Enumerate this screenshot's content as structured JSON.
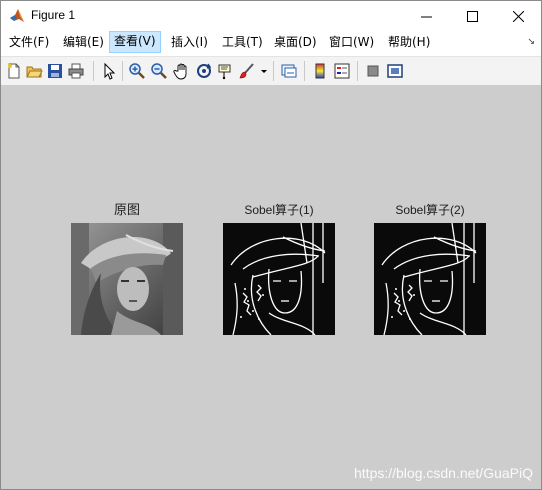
{
  "window": {
    "title": "Figure 1",
    "icon": "matlab-icon"
  },
  "menu": {
    "items": [
      {
        "label": "文件(F)",
        "active": false
      },
      {
        "label": "编辑(E)",
        "active": false
      },
      {
        "label": "查看(V)",
        "active": true
      },
      {
        "label": "插入(I)",
        "active": false
      },
      {
        "label": "工具(T)",
        "active": false
      },
      {
        "label": "桌面(D)",
        "active": false
      },
      {
        "label": "窗口(W)",
        "active": false
      },
      {
        "label": "帮助(H)",
        "active": false
      }
    ]
  },
  "toolbar": {
    "icons": [
      "new-figure-icon",
      "open-file-icon",
      "save-icon",
      "print-icon",
      "select-arrow-icon",
      "zoom-in-icon",
      "zoom-out-icon",
      "pan-hand-icon",
      "rotate-3d-icon",
      "data-cursor-icon",
      "brush-icon",
      "brush-dropdown-icon",
      "link-plot-icon",
      "colorbar-icon",
      "legend-icon",
      "hide-plot-tools-icon",
      "show-plot-tools-icon"
    ]
  },
  "axes": [
    {
      "title": "原图",
      "image": "grayscale-portrait"
    },
    {
      "title": "Sobel算子(1)",
      "image": "edge-map"
    },
    {
      "title": "Sobel算子(2)",
      "image": "edge-map"
    }
  ],
  "watermark": "https://blog.csdn.net/GuaPiQ",
  "colors": {
    "canvas": "#cdcdcd",
    "menu_active": "#cce8ff"
  }
}
